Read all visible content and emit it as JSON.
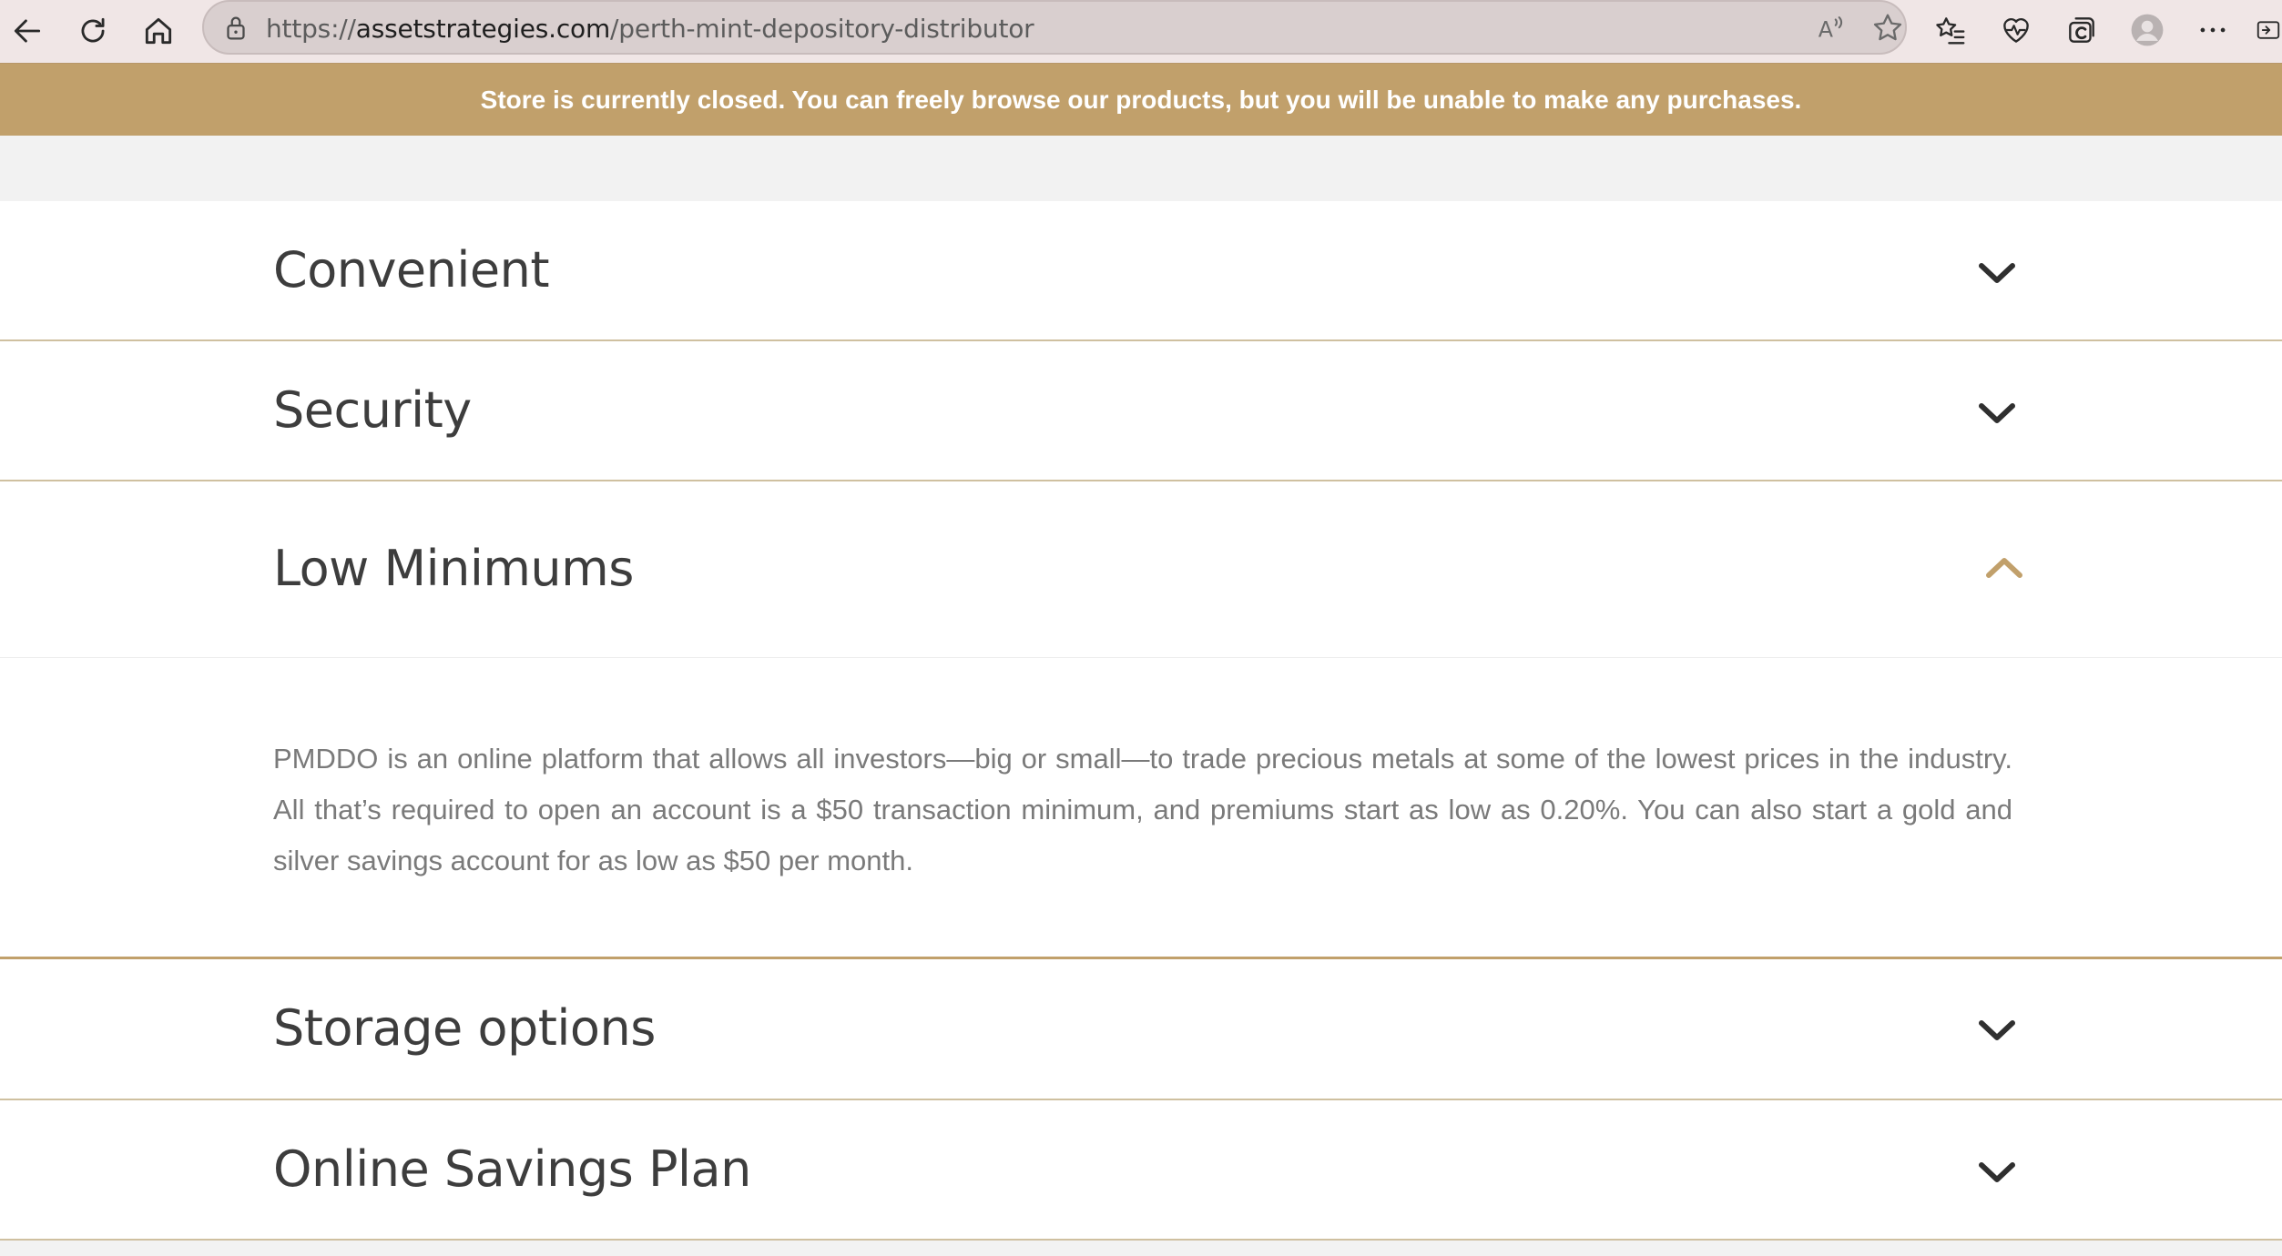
{
  "browser": {
    "url_prefix": "https://",
    "url_host": "assetstrategies.com",
    "url_path": "/perth-mint-depository-distributor"
  },
  "banner": {
    "text": "Store is currently closed. You can freely browse our products, but you will be unable to make any purchases."
  },
  "accordion": {
    "items": [
      {
        "title": "Convenient",
        "expanded": false
      },
      {
        "title": "Security",
        "expanded": false
      },
      {
        "title": "Low Minimums",
        "expanded": true,
        "body": "PMDDO is an online platform that allows all investors—big or small—to trade precious metals at some of the lowest prices in the industry. All that’s required to open an account is a $50 transaction minimum, and premiums start as low as 0.20%. You can also start a gold and silver savings account for as low as $50 per month."
      },
      {
        "title": "Storage options",
        "expanded": false
      },
      {
        "title": "Online Savings Plan",
        "expanded": false
      }
    ]
  },
  "colors": {
    "accent": "#c1a06b",
    "chevron_collapsed": "#2f2f2f",
    "chevron_expanded": "#c1a06b"
  }
}
